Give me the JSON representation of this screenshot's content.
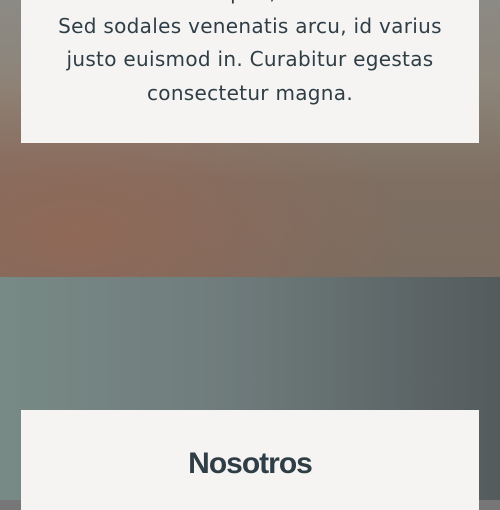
{
  "intro_card": {
    "line0": "Aliquet, ...",
    "line1": "Sed sodales venenatis arcu, id varius",
    "line2": "justo euismod in. Curabitur egestas",
    "line3": "consectetur magna."
  },
  "about_card": {
    "heading": "Nosotros"
  }
}
